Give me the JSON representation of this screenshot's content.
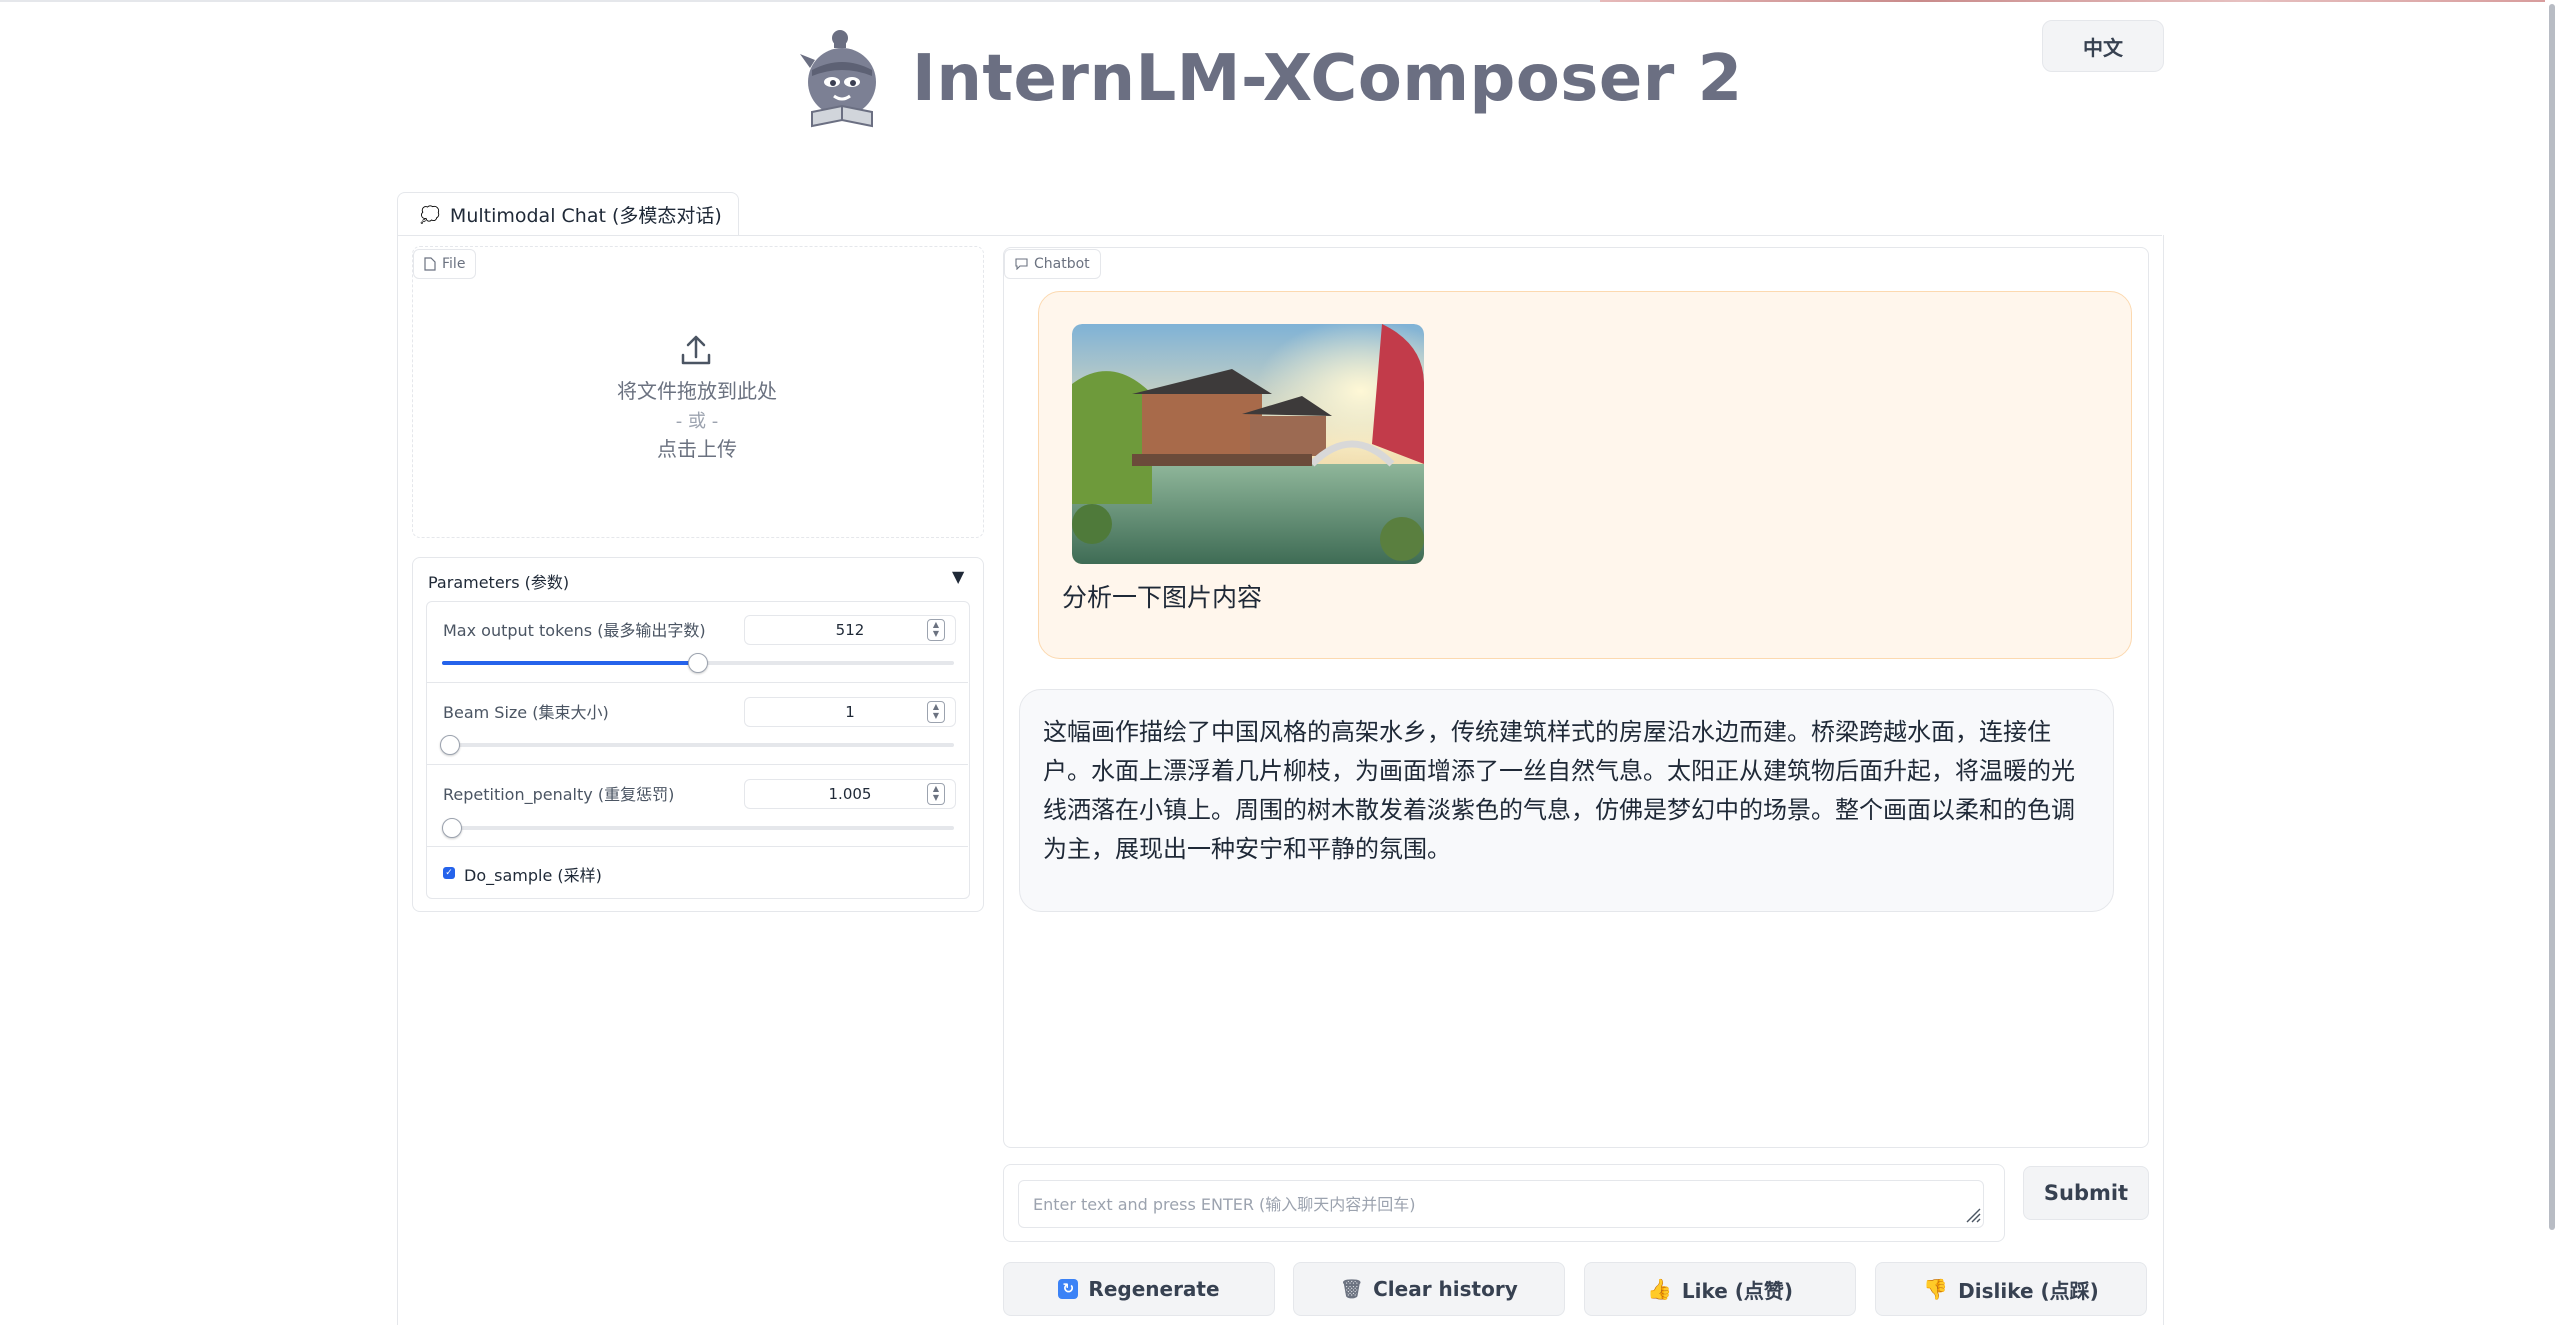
{
  "app": {
    "title": "InternLM-XComposer 2",
    "language_button": "中文"
  },
  "tab": {
    "label": "Multimodal Chat (多模态对话)",
    "icon": "chat-bubble-icon"
  },
  "file_upload": {
    "label": "File",
    "drop_text": "将文件拖放到此处",
    "or_text": "- 或 -",
    "click_text": "点击上传"
  },
  "parameters": {
    "title": "Parameters (参数)",
    "max_tokens": {
      "label": "Max output tokens (最多输出字数)",
      "value": "512",
      "fraction": 0.5
    },
    "beam_size": {
      "label": "Beam Size (集束大小)",
      "value": "1",
      "fraction": 0.0
    },
    "repetition_penalty": {
      "label": "Repetition_penalty (重复惩罚)",
      "value": "1.005",
      "fraction": 0.005
    },
    "do_sample": {
      "label": "Do_sample (采样)",
      "checked": true
    }
  },
  "chatbot": {
    "label": "Chatbot",
    "user_message": "分析一下图片内容",
    "bot_message": "这幅画作描绘了中国风格的高架水乡，传统建筑样式的房屋沿水边而建。桥梁跨越水面，连接住户。水面上漂浮着几片柳枝，为画面增添了一丝自然气息。太阳正从建筑物后面升起，将温暖的光线洒落在小镇上。周围的树木散发着淡紫色的气息，仿佛是梦幻中的场景。整个画面以柔和的色调为主，展现出一种安宁和平静的氛围。"
  },
  "input": {
    "placeholder": "Enter text and press ENTER (输入聊天内容并回车)",
    "submit_label": "Submit"
  },
  "actions": {
    "regenerate": "Regenerate",
    "clear": "Clear history",
    "like": "Like (点赞)",
    "dislike": "Dislike (点踩)"
  },
  "colors": {
    "accent": "#2563eb",
    "user_bubble": "#fff6ec",
    "title": "#6b6f82"
  }
}
